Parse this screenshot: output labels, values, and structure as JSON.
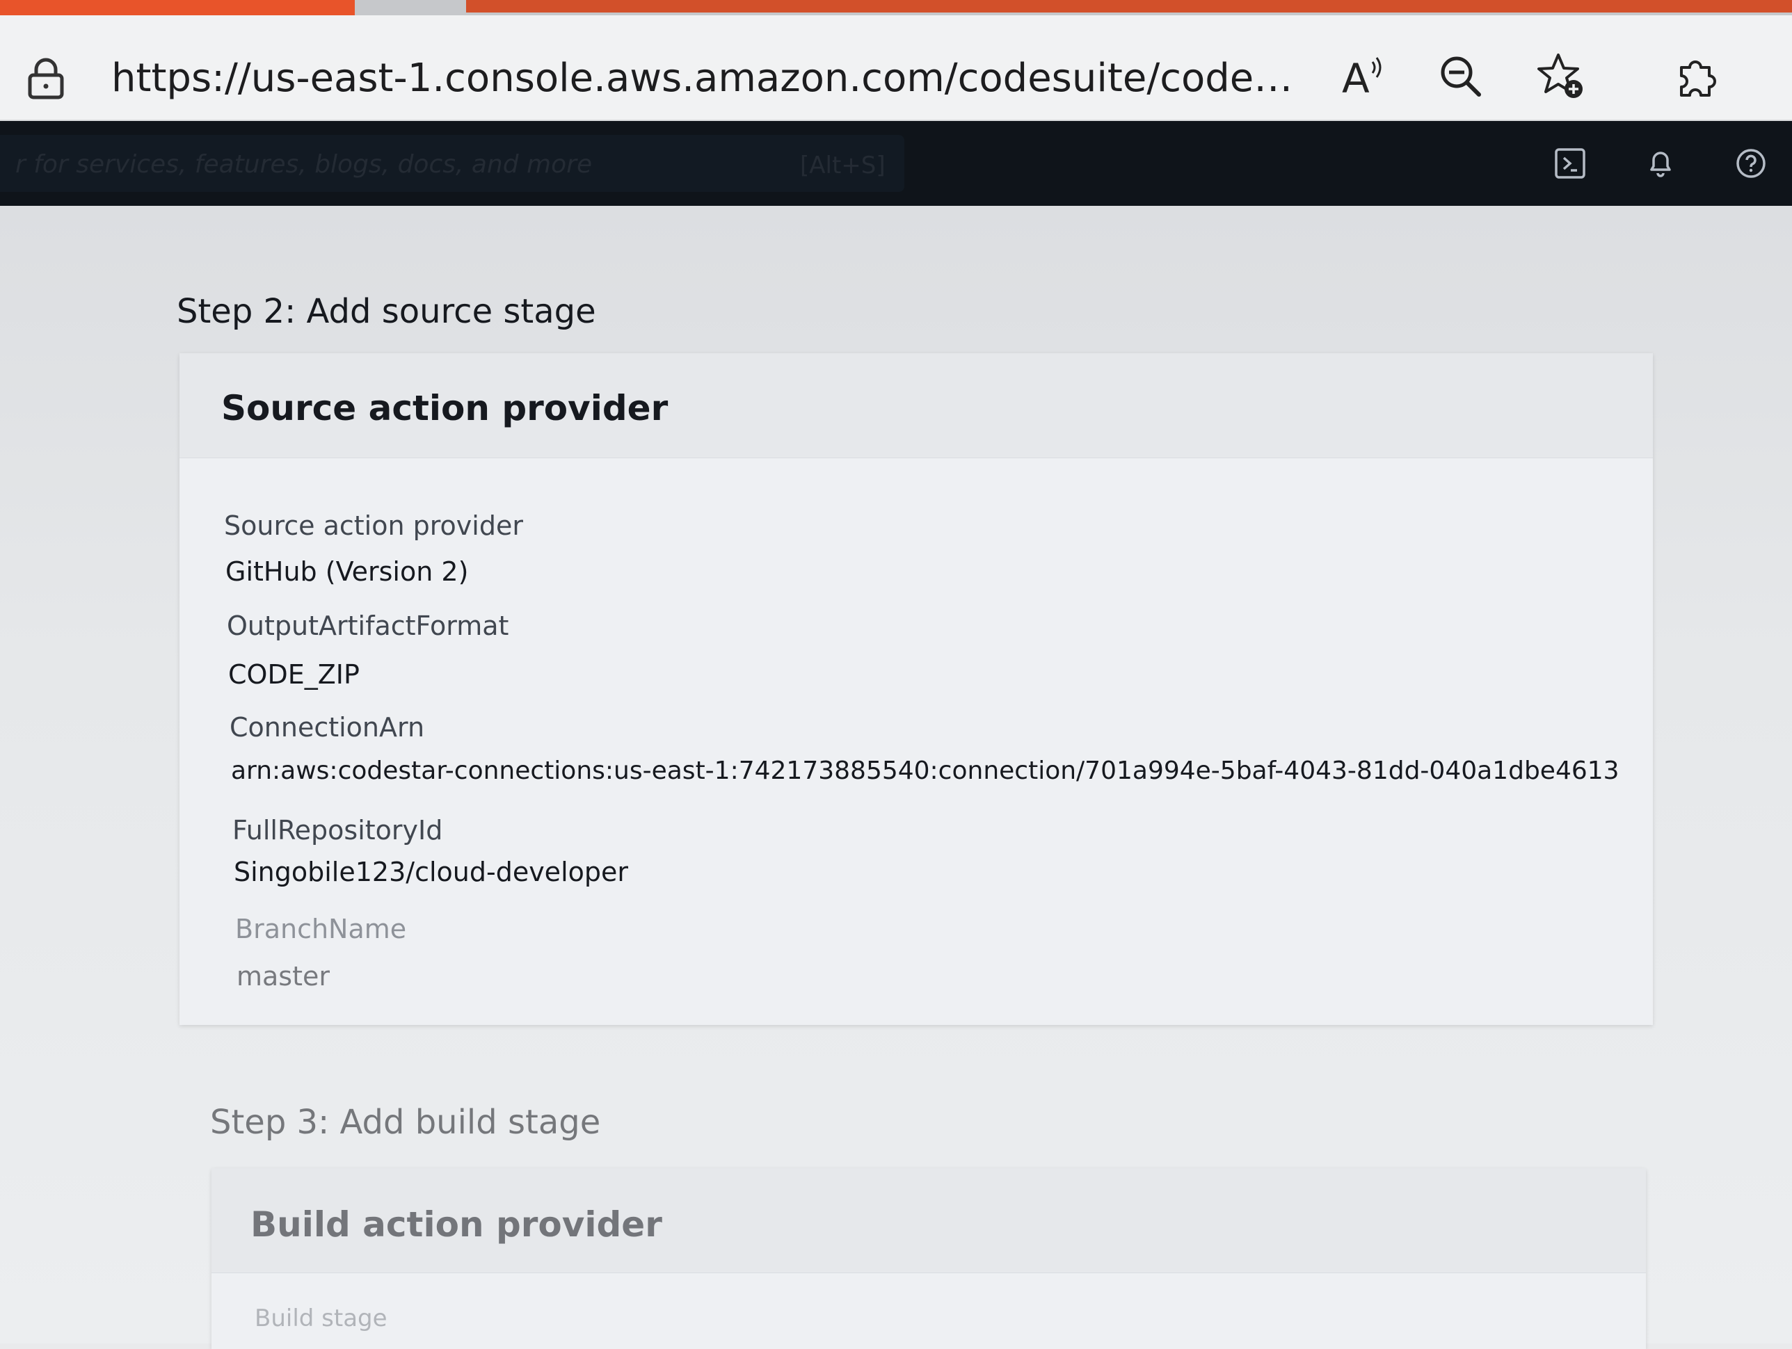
{
  "browser": {
    "url": "https://us-east-1.console.aws.amazon.com/codesuite/codepipeline/...",
    "icons": [
      "lock-icon",
      "read-aloud-icon",
      "zoom-out-icon",
      "add-favorite-icon",
      "extensions-icon"
    ]
  },
  "aws_nav": {
    "search_placeholder": "r for services, features, blogs, docs, and more",
    "search_shortcut": "[Alt+S]",
    "icons": [
      "cloudshell-icon",
      "notifications-bell-icon",
      "help-icon"
    ]
  },
  "step2": {
    "title": "Step 2: Add source stage",
    "panel_title": "Source action provider",
    "fields": [
      {
        "label": "Source action provider",
        "value": "GitHub (Version 2)"
      },
      {
        "label": "OutputArtifactFormat",
        "value": "CODE_ZIP"
      },
      {
        "label": "ConnectionArn",
        "value": "arn:aws:codestar-connections:us-east-1:742173885540:connection/701a994e-5baf-4043-81dd-040a1dbe4613"
      },
      {
        "label": "FullRepositoryId",
        "value": "Singobile123/cloud-developer"
      },
      {
        "label": "BranchName",
        "value": "master"
      }
    ]
  },
  "step3": {
    "title": "Step 3: Add build stage",
    "panel_title": "Build action provider",
    "first_label": "Build stage"
  },
  "colors": {
    "aws_nav_bg": "#0f141a",
    "tab_accent": "#e8542a",
    "panel_bg": "#eef0f3"
  }
}
